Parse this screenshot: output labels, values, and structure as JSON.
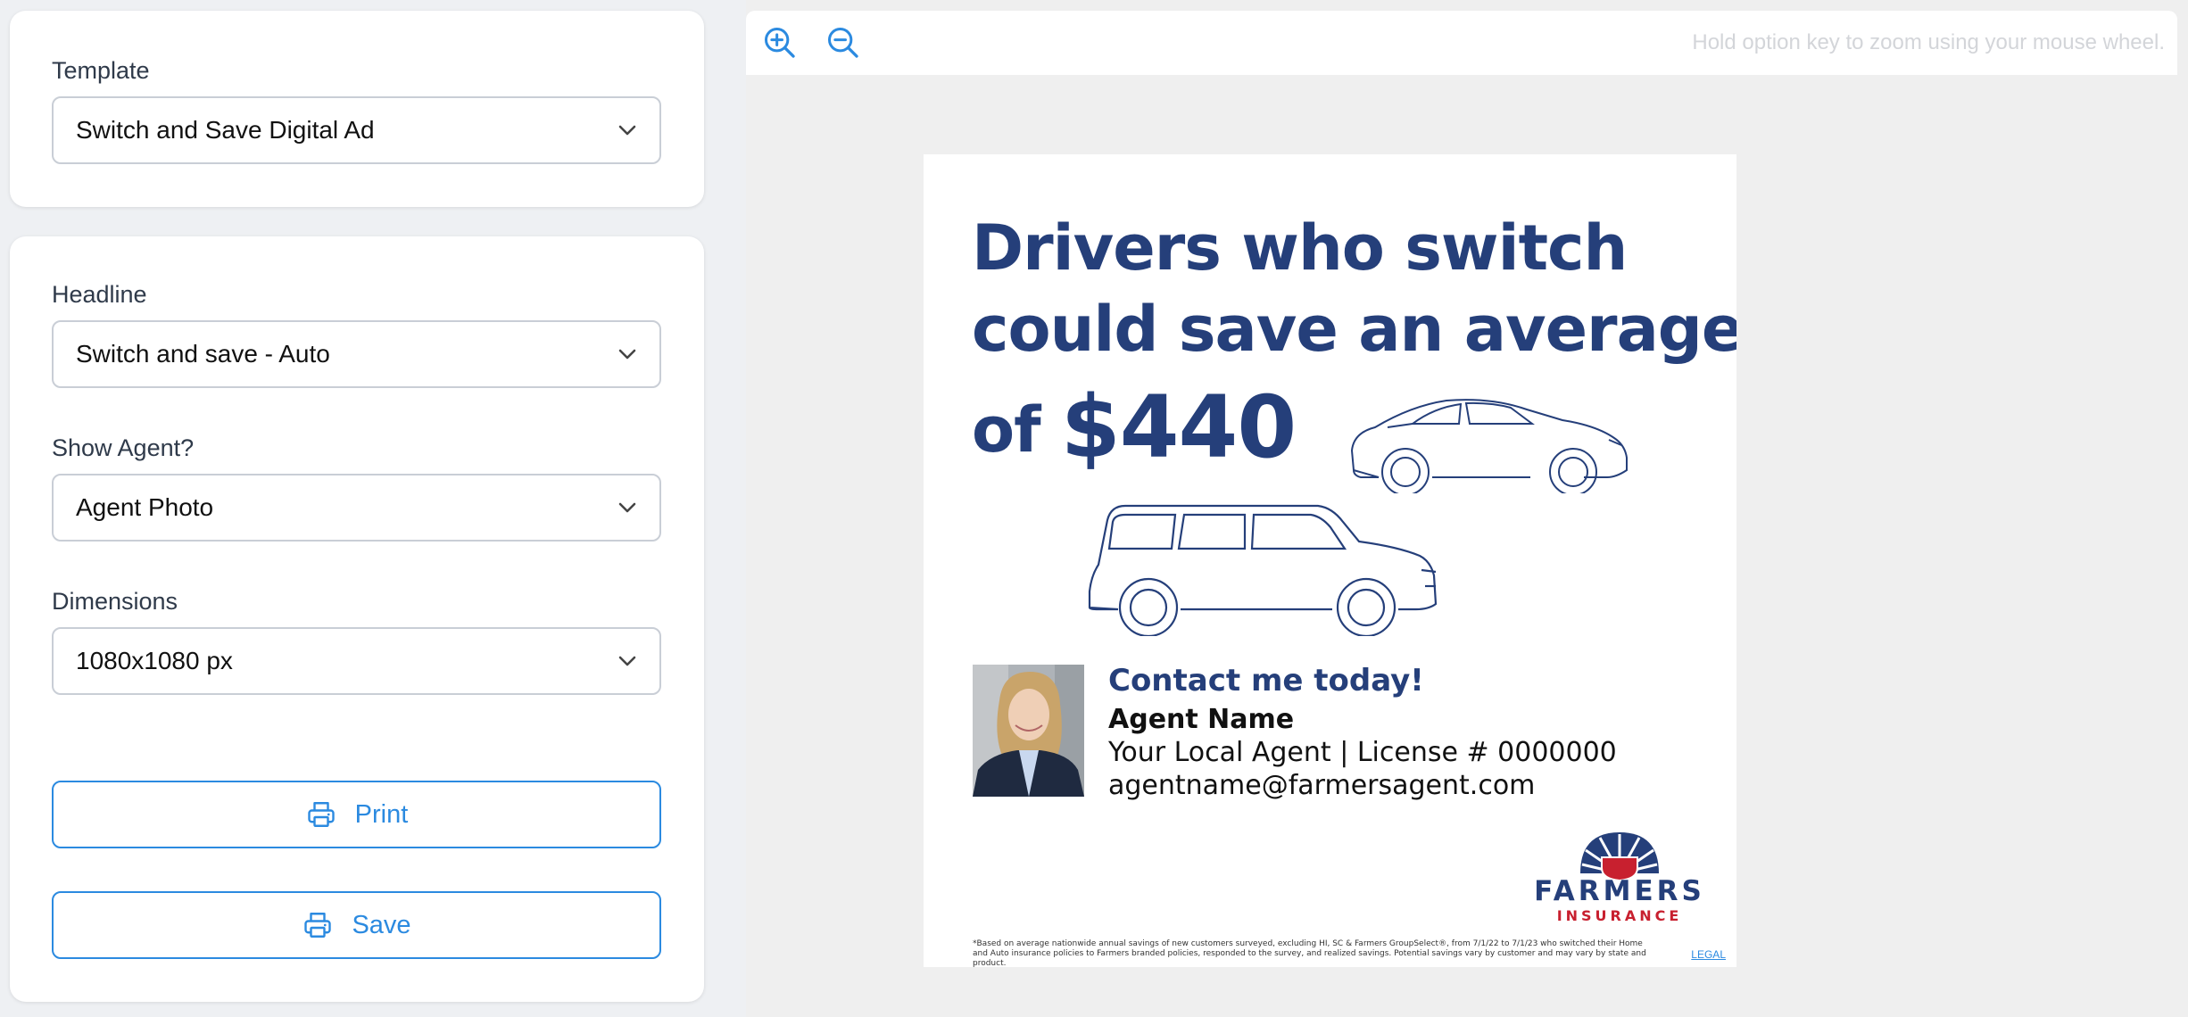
{
  "template": {
    "label": "Template",
    "selected": "Switch and Save Digital Ad"
  },
  "options": {
    "headline": {
      "label": "Headline",
      "selected": "Switch and save - Auto"
    },
    "show_agent": {
      "label": "Show Agent?",
      "selected": "Agent Photo"
    },
    "dimensions": {
      "label": "Dimensions",
      "selected": "1080x1080 px"
    },
    "print_label": "Print",
    "save_label": "Save"
  },
  "toolbar": {
    "zoom_in_icon": "zoom-in-icon",
    "zoom_out_icon": "zoom-out-icon",
    "hint": "Hold option key to zoom using your mouse wheel."
  },
  "ad": {
    "headline_line1": "Drivers who switch",
    "headline_line2": "could save an average",
    "headline_line3_prefix": "of",
    "headline_amount": "$440",
    "contact_cta": "Contact me today!",
    "agent_name": "Agent Name",
    "agent_role": "Your Local Agent | License # 0000000",
    "agent_email": "agentname@farmersagent.com",
    "logo_word": "FARMERS",
    "logo_sub": "INSURANCE",
    "disclaimer": "*Based on average nationwide annual savings of new customers surveyed, excluding HI, SC & Farmers GroupSelect®, from 7/1/22 to 7/1/23 who switched their Home and Auto insurance policies to Farmers branded policies, responded to the survey, and realized savings. Potential savings vary by customer and may vary by state and product.",
    "legal_link": "LEGAL"
  },
  "colors": {
    "brand_blue": "#253f7a",
    "brand_red": "#c8202f",
    "accent": "#2b8ae0"
  }
}
